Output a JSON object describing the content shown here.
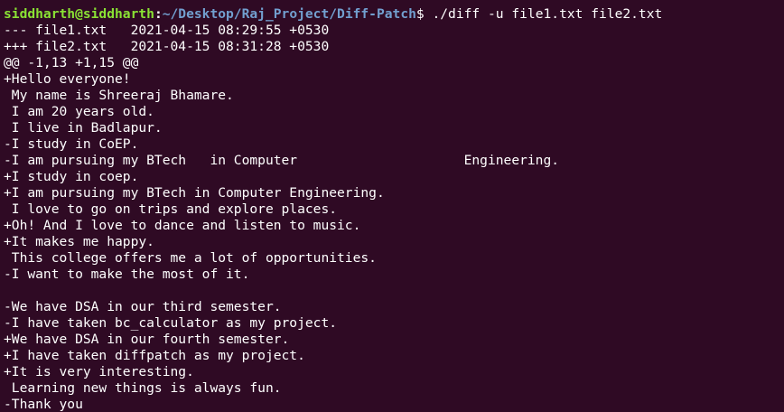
{
  "prompt": {
    "user_host": "siddharth@siddharth",
    "separator": ":",
    "path": "~/Desktop/Raj_Project/Diff-Patch",
    "symbol": "$",
    "command": " ./diff -u file1.txt file2.txt"
  },
  "colors": {
    "background": "#2f0a24",
    "text": "#ffffff",
    "user_host": "#8ae234",
    "path": "#729fcf"
  },
  "output": [
    "--- file1.txt   2021-04-15 08:29:55 +0530",
    "+++ file2.txt   2021-04-15 08:31:28 +0530",
    "@@ -1,13 +1,15 @@",
    "+Hello everyone!",
    " My name is Shreeraj Bhamare.",
    " I am 20 years old.",
    " I live in Badlapur.",
    "-I study in CoEP.",
    "-I am pursuing my BTech   in Computer                     Engineering.",
    "+I study in coep.",
    "+I am pursuing my BTech in Computer Engineering.",
    " I love to go on trips and explore places.",
    "+Oh! And I love to dance and listen to music.",
    "+It makes me happy.",
    " This college offers me a lot of opportunities.",
    "-I want to make the most of it.",
    "",
    "-We have DSA in our third semester.",
    "-I have taken bc_calculator as my project.",
    "+We have DSA in our fourth semester.",
    "+I have taken diffpatch as my project.",
    "+It is very interesting.",
    " Learning new things is always fun.",
    "-Thank you"
  ]
}
